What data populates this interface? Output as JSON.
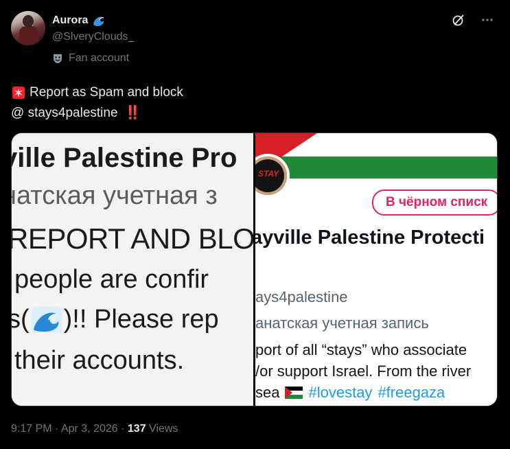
{
  "author": {
    "display_name": "Aurora",
    "name_emoji": "wave-emoji",
    "handle": "@SlveryClouds_",
    "label": "Fan account",
    "label_icon": "theater-mask-icon"
  },
  "header_icons": [
    "grok-icon",
    "more-icon"
  ],
  "tweet": {
    "line1_emoji": "rotating-light-emoji",
    "line1_text": "Report as Spam and block",
    "line2_text": "@ stays4palestine",
    "line2_emoji": "‼️"
  },
  "media": {
    "left": {
      "line1": "ville Palestine Pro",
      "line2": "натская учетная з",
      "line3": "REPORT AND BLO",
      "line4": "people are confir",
      "line5_a": "s(",
      "line5_b": ")!! Please rep",
      "line6": "their accounts."
    },
    "right": {
      "badge": "В чёрном списк",
      "profile_pic_text": "STAY",
      "name": "ayville Palestine Protecti",
      "handle": "ays4palestine",
      "label": "анатская учетная запись",
      "bio1": "port of all “stays” who associate",
      "bio2": "/or support Israel.  From the river",
      "bio3_text": "sea",
      "bio3_tag1": "#lovestay",
      "bio3_tag2": "#freegaza"
    }
  },
  "meta": {
    "time": "9:17 PM",
    "sep1": " · ",
    "date": "Apr 3, 2026",
    "sep2": " · ",
    "views_count": "137",
    "views_label": " Views"
  },
  "colors": {
    "background": "#000000",
    "text_primary": "#e7e9ea",
    "text_secondary": "#71767b",
    "accent_red": "#f4212e",
    "link_blue": "#1d9bf0"
  }
}
